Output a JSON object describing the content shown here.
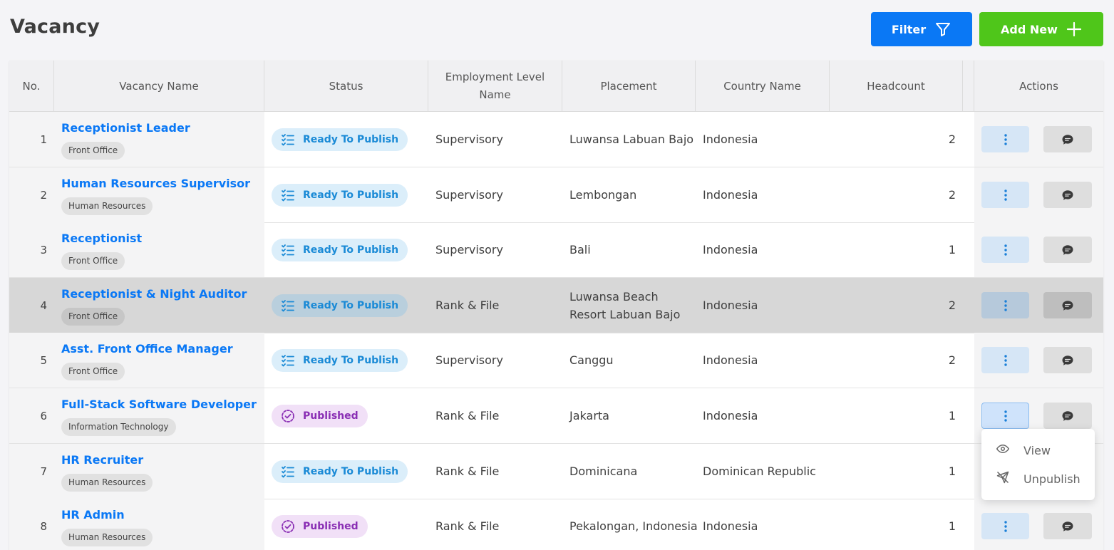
{
  "header": {
    "title": "Vacancy",
    "filter_label": "Filter",
    "add_label": "Add New"
  },
  "colors": {
    "primary": "#0a78f5",
    "success": "#4fc61a",
    "ready_bg": "#dbeefa",
    "ready_fg": "#1a8ad6",
    "published_bg": "#f1e0f7",
    "published_fg": "#8a2fb4"
  },
  "table": {
    "columns": [
      "No.",
      "Vacancy Name",
      "Status",
      "Employment Level Name",
      "Placement",
      "Country Name",
      "Headcount",
      "Actions"
    ],
    "rows": [
      {
        "no": "1",
        "name": "Receptionist Leader",
        "dept": "Front Office",
        "status": "Ready To Publish",
        "status_type": "ready",
        "level": "Supervisory",
        "placement": "Luwansa Labuan Bajo",
        "country": "Indonesia",
        "headcount": "2"
      },
      {
        "no": "2",
        "name": "Human Resources Supervisor",
        "dept": "Human Resources",
        "status": "Ready To Publish",
        "status_type": "ready",
        "level": "Supervisory",
        "placement": "Lembongan",
        "country": "Indonesia",
        "headcount": "2"
      },
      {
        "no": "3",
        "name": "Receptionist",
        "dept": "Front Office",
        "status": "Ready To Publish",
        "status_type": "ready",
        "level": "Supervisory",
        "placement": "Bali",
        "country": "Indonesia",
        "headcount": "1"
      },
      {
        "no": "4",
        "name": "Receptionist & Night Auditor",
        "dept": "Front Office",
        "status": "Ready To Publish",
        "status_type": "ready",
        "level": "Rank & File",
        "placement": "Luwansa Beach Resort Labuan Bajo",
        "country": "Indonesia",
        "headcount": "2"
      },
      {
        "no": "5",
        "name": "Asst. Front Office Manager",
        "dept": "Front Office",
        "status": "Ready To Publish",
        "status_type": "ready",
        "level": "Supervisory",
        "placement": "Canggu",
        "country": "Indonesia",
        "headcount": "2"
      },
      {
        "no": "6",
        "name": "Full-Stack Software Developer",
        "dept": "Information Technology",
        "status": "Published",
        "status_type": "published",
        "level": "Rank & File",
        "placement": "Jakarta",
        "country": "Indonesia",
        "headcount": "1"
      },
      {
        "no": "7",
        "name": "HR Recruiter",
        "dept": "Human Resources",
        "status": "Ready To Publish",
        "status_type": "ready",
        "level": "Rank & File",
        "placement": "Dominicana",
        "country": "Dominican Republic",
        "headcount": "1"
      },
      {
        "no": "8",
        "name": "HR Admin",
        "dept": "Human Resources",
        "status": "Published",
        "status_type": "published",
        "level": "Rank & File",
        "placement": "Pekalongan, Indonesia",
        "country": "Indonesia",
        "headcount": "1"
      }
    ]
  },
  "context_menu": {
    "items": [
      {
        "label": "View",
        "icon": "eye-icon"
      },
      {
        "label": "Unpublish",
        "icon": "send-off-icon"
      }
    ]
  }
}
